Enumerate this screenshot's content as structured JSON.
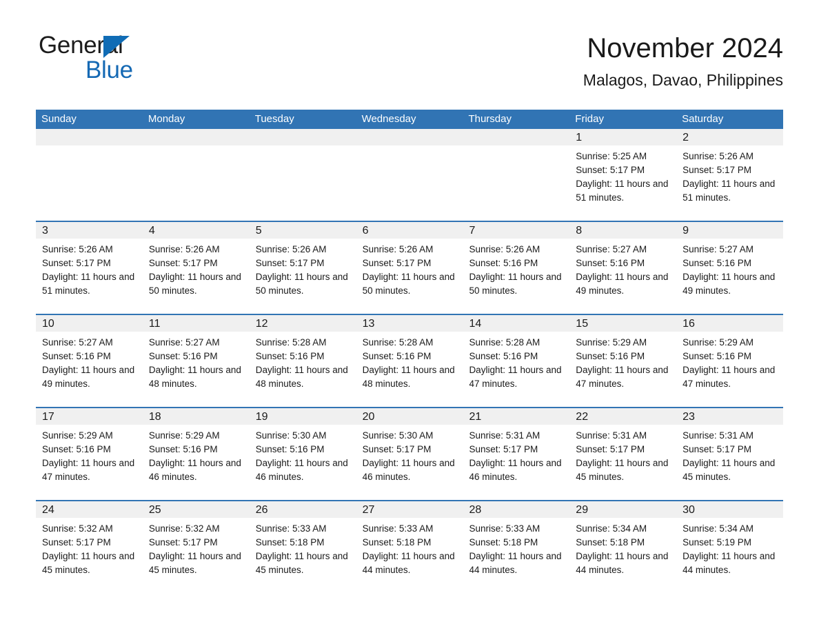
{
  "brand": {
    "name_part1": "General",
    "name_part2": "Blue",
    "triangle_icon": "triangle-icon",
    "accent_color": "#1569b4"
  },
  "header": {
    "title": "November 2024",
    "location": "Malagos, Davao, Philippines"
  },
  "colors": {
    "header_blue": "#3174b4",
    "day_band_gray": "#f0f0f0",
    "text": "#1a1a1a"
  },
  "calendar": {
    "weekdays": [
      "Sunday",
      "Monday",
      "Tuesday",
      "Wednesday",
      "Thursday",
      "Friday",
      "Saturday"
    ],
    "weeks": [
      [
        {
          "day": "",
          "empty": true
        },
        {
          "day": "",
          "empty": true
        },
        {
          "day": "",
          "empty": true
        },
        {
          "day": "",
          "empty": true
        },
        {
          "day": "",
          "empty": true
        },
        {
          "day": "1",
          "sunrise": "Sunrise: 5:25 AM",
          "sunset": "Sunset: 5:17 PM",
          "daylight": "Daylight: 11 hours and 51 minutes."
        },
        {
          "day": "2",
          "sunrise": "Sunrise: 5:26 AM",
          "sunset": "Sunset: 5:17 PM",
          "daylight": "Daylight: 11 hours and 51 minutes."
        }
      ],
      [
        {
          "day": "3",
          "sunrise": "Sunrise: 5:26 AM",
          "sunset": "Sunset: 5:17 PM",
          "daylight": "Daylight: 11 hours and 51 minutes."
        },
        {
          "day": "4",
          "sunrise": "Sunrise: 5:26 AM",
          "sunset": "Sunset: 5:17 PM",
          "daylight": "Daylight: 11 hours and 50 minutes."
        },
        {
          "day": "5",
          "sunrise": "Sunrise: 5:26 AM",
          "sunset": "Sunset: 5:17 PM",
          "daylight": "Daylight: 11 hours and 50 minutes."
        },
        {
          "day": "6",
          "sunrise": "Sunrise: 5:26 AM",
          "sunset": "Sunset: 5:17 PM",
          "daylight": "Daylight: 11 hours and 50 minutes."
        },
        {
          "day": "7",
          "sunrise": "Sunrise: 5:26 AM",
          "sunset": "Sunset: 5:16 PM",
          "daylight": "Daylight: 11 hours and 50 minutes."
        },
        {
          "day": "8",
          "sunrise": "Sunrise: 5:27 AM",
          "sunset": "Sunset: 5:16 PM",
          "daylight": "Daylight: 11 hours and 49 minutes."
        },
        {
          "day": "9",
          "sunrise": "Sunrise: 5:27 AM",
          "sunset": "Sunset: 5:16 PM",
          "daylight": "Daylight: 11 hours and 49 minutes."
        }
      ],
      [
        {
          "day": "10",
          "sunrise": "Sunrise: 5:27 AM",
          "sunset": "Sunset: 5:16 PM",
          "daylight": "Daylight: 11 hours and 49 minutes."
        },
        {
          "day": "11",
          "sunrise": "Sunrise: 5:27 AM",
          "sunset": "Sunset: 5:16 PM",
          "daylight": "Daylight: 11 hours and 48 minutes."
        },
        {
          "day": "12",
          "sunrise": "Sunrise: 5:28 AM",
          "sunset": "Sunset: 5:16 PM",
          "daylight": "Daylight: 11 hours and 48 minutes."
        },
        {
          "day": "13",
          "sunrise": "Sunrise: 5:28 AM",
          "sunset": "Sunset: 5:16 PM",
          "daylight": "Daylight: 11 hours and 48 minutes."
        },
        {
          "day": "14",
          "sunrise": "Sunrise: 5:28 AM",
          "sunset": "Sunset: 5:16 PM",
          "daylight": "Daylight: 11 hours and 47 minutes."
        },
        {
          "day": "15",
          "sunrise": "Sunrise: 5:29 AM",
          "sunset": "Sunset: 5:16 PM",
          "daylight": "Daylight: 11 hours and 47 minutes."
        },
        {
          "day": "16",
          "sunrise": "Sunrise: 5:29 AM",
          "sunset": "Sunset: 5:16 PM",
          "daylight": "Daylight: 11 hours and 47 minutes."
        }
      ],
      [
        {
          "day": "17",
          "sunrise": "Sunrise: 5:29 AM",
          "sunset": "Sunset: 5:16 PM",
          "daylight": "Daylight: 11 hours and 47 minutes."
        },
        {
          "day": "18",
          "sunrise": "Sunrise: 5:29 AM",
          "sunset": "Sunset: 5:16 PM",
          "daylight": "Daylight: 11 hours and 46 minutes."
        },
        {
          "day": "19",
          "sunrise": "Sunrise: 5:30 AM",
          "sunset": "Sunset: 5:16 PM",
          "daylight": "Daylight: 11 hours and 46 minutes."
        },
        {
          "day": "20",
          "sunrise": "Sunrise: 5:30 AM",
          "sunset": "Sunset: 5:17 PM",
          "daylight": "Daylight: 11 hours and 46 minutes."
        },
        {
          "day": "21",
          "sunrise": "Sunrise: 5:31 AM",
          "sunset": "Sunset: 5:17 PM",
          "daylight": "Daylight: 11 hours and 46 minutes."
        },
        {
          "day": "22",
          "sunrise": "Sunrise: 5:31 AM",
          "sunset": "Sunset: 5:17 PM",
          "daylight": "Daylight: 11 hours and 45 minutes."
        },
        {
          "day": "23",
          "sunrise": "Sunrise: 5:31 AM",
          "sunset": "Sunset: 5:17 PM",
          "daylight": "Daylight: 11 hours and 45 minutes."
        }
      ],
      [
        {
          "day": "24",
          "sunrise": "Sunrise: 5:32 AM",
          "sunset": "Sunset: 5:17 PM",
          "daylight": "Daylight: 11 hours and 45 minutes."
        },
        {
          "day": "25",
          "sunrise": "Sunrise: 5:32 AM",
          "sunset": "Sunset: 5:17 PM",
          "daylight": "Daylight: 11 hours and 45 minutes."
        },
        {
          "day": "26",
          "sunrise": "Sunrise: 5:33 AM",
          "sunset": "Sunset: 5:18 PM",
          "daylight": "Daylight: 11 hours and 45 minutes."
        },
        {
          "day": "27",
          "sunrise": "Sunrise: 5:33 AM",
          "sunset": "Sunset: 5:18 PM",
          "daylight": "Daylight: 11 hours and 44 minutes."
        },
        {
          "day": "28",
          "sunrise": "Sunrise: 5:33 AM",
          "sunset": "Sunset: 5:18 PM",
          "daylight": "Daylight: 11 hours and 44 minutes."
        },
        {
          "day": "29",
          "sunrise": "Sunrise: 5:34 AM",
          "sunset": "Sunset: 5:18 PM",
          "daylight": "Daylight: 11 hours and 44 minutes."
        },
        {
          "day": "30",
          "sunrise": "Sunrise: 5:34 AM",
          "sunset": "Sunset: 5:19 PM",
          "daylight": "Daylight: 11 hours and 44 minutes."
        }
      ]
    ]
  }
}
